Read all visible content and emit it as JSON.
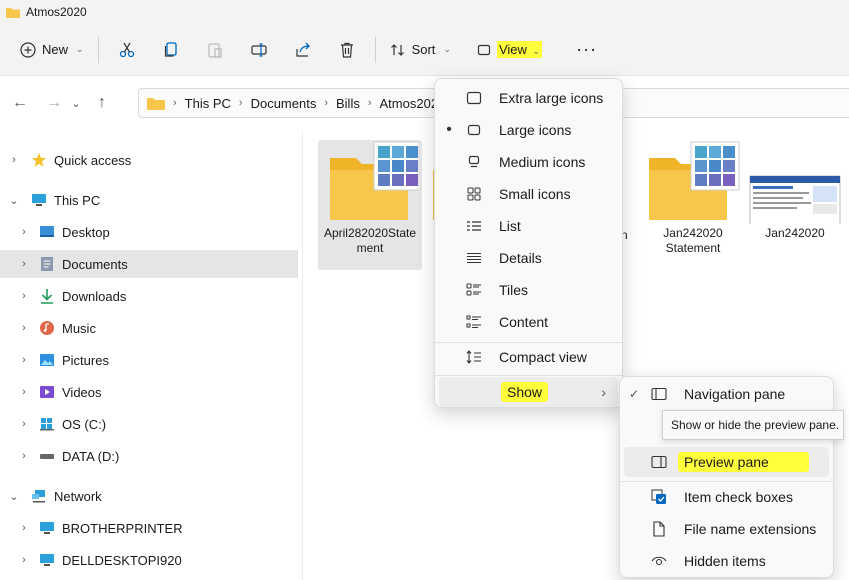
{
  "window": {
    "title": "Atmos2020"
  },
  "toolbar": {
    "new_label": "New",
    "sort_label": "Sort",
    "view_label": "View",
    "icons": [
      "cut-icon",
      "copy-icon",
      "paste-icon",
      "rename-icon",
      "share-icon",
      "delete-icon",
      "more-icon"
    ]
  },
  "address": {
    "breadcrumbs": [
      "This PC",
      "Documents",
      "Bills",
      "Atmos2020"
    ]
  },
  "sidebar": {
    "items": [
      {
        "label": "Quick access"
      },
      {
        "label": "This PC"
      },
      {
        "label": "Desktop"
      },
      {
        "label": "Documents"
      },
      {
        "label": "Downloads"
      },
      {
        "label": "Music"
      },
      {
        "label": "Pictures"
      },
      {
        "label": "Videos"
      },
      {
        "label": "OS (C:)"
      },
      {
        "label": "DATA (D:)"
      },
      {
        "label": "Network"
      },
      {
        "label": "BROTHERPRINTER"
      },
      {
        "label": "DELLDESKTOPI920"
      }
    ]
  },
  "files": [
    {
      "name": "April282020State\nment"
    },
    {
      "name": "n"
    },
    {
      "name": "Jan242020\nStatement"
    },
    {
      "name": "Jan242020"
    }
  ],
  "view_menu": {
    "items": [
      {
        "label": "Extra large icons",
        "icon": "extra-large-icons-icon"
      },
      {
        "label": "Large icons",
        "icon": "large-icons-icon",
        "selected_mark": "•"
      },
      {
        "label": "Medium icons",
        "icon": "medium-icons-icon"
      },
      {
        "label": "Small icons",
        "icon": "small-icons-icon"
      },
      {
        "label": "List",
        "icon": "list-icon"
      },
      {
        "label": "Details",
        "icon": "details-icon"
      },
      {
        "label": "Tiles",
        "icon": "tiles-icon"
      },
      {
        "label": "Content",
        "icon": "content-icon"
      },
      {
        "label": "Compact view",
        "icon": "compact-view-icon"
      },
      {
        "label": "Show",
        "icon": "chevron-right-icon"
      }
    ]
  },
  "show_menu": {
    "items": [
      {
        "label": "Navigation pane",
        "checked_mark": "✓"
      },
      {
        "label": "Preview pane"
      },
      {
        "label": "Item check boxes"
      },
      {
        "label": "File name extensions"
      },
      {
        "label": "Hidden items"
      }
    ],
    "tooltip": "Show or hide the preview pane."
  },
  "colors": {
    "highlight": "#ffff3b",
    "folder": "#f8c64a",
    "selection": "#e5e5e5",
    "accent": "#0067c0"
  }
}
